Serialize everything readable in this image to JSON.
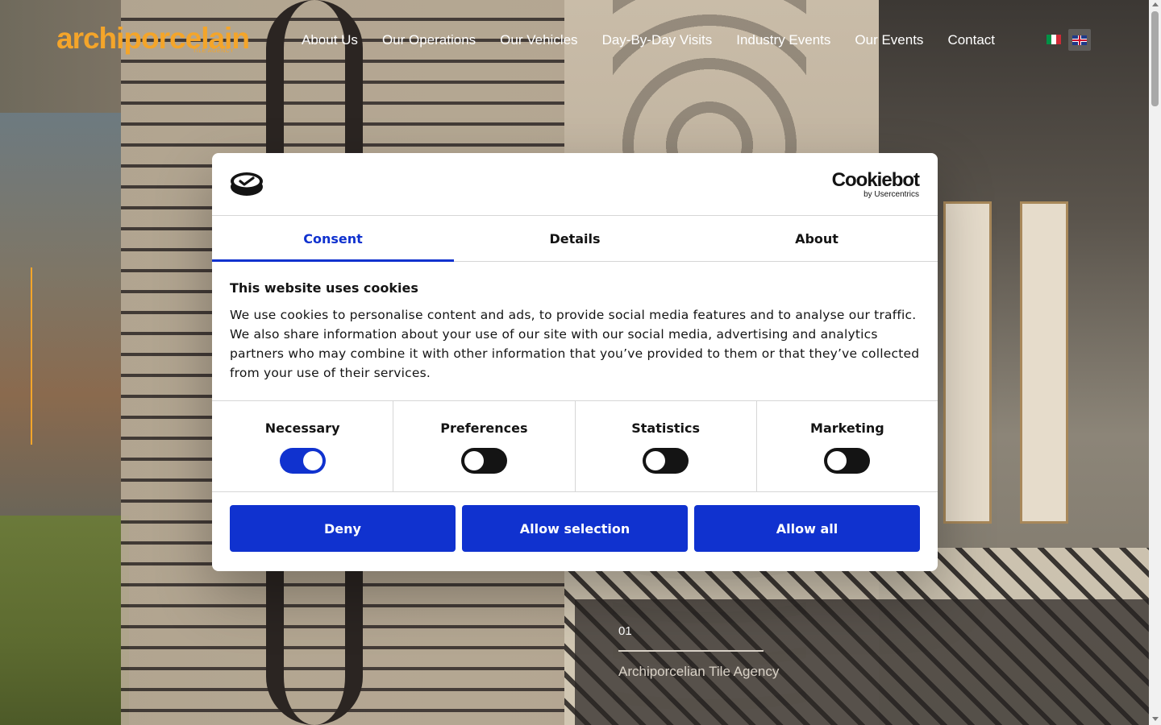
{
  "site": {
    "logo_text": "archiporcelain",
    "logo_sub": "TILE AGENCY",
    "nav": [
      {
        "label": "About Us"
      },
      {
        "label": "Our Operations"
      },
      {
        "label": "Our Vehicles"
      },
      {
        "label": "Day-By-Day Visits"
      },
      {
        "label": "Industry Events"
      },
      {
        "label": "Our Events"
      },
      {
        "label": "Contact"
      }
    ],
    "languages": [
      {
        "code": "it",
        "icon": "italian-flag-icon"
      },
      {
        "code": "en",
        "icon": "uk-flag-icon",
        "selected": true
      }
    ],
    "accent_color": "#f4a52a"
  },
  "hero": {
    "slide_number": "01",
    "caption": "Archiporcelian Tile Agency"
  },
  "cookie_dialog": {
    "brand_name": "Cookiebot",
    "brand_by": "by Usercentrics",
    "logo_icon": "cookiebot-logo-icon",
    "tabs": [
      {
        "label": "Consent",
        "active": true
      },
      {
        "label": "Details",
        "active": false
      },
      {
        "label": "About",
        "active": false
      }
    ],
    "title": "This website uses cookies",
    "body": "We use cookies to personalise content and ads, to provide social media features and to analyse our traffic. We also share information about your use of our site with our social media, advertising and analytics partners who may combine it with other information that you’ve provided to them or that they’ve collected from your use of their services.",
    "toggles": [
      {
        "label": "Necessary",
        "on": true
      },
      {
        "label": "Preferences",
        "on": false
      },
      {
        "label": "Statistics",
        "on": false
      },
      {
        "label": "Marketing",
        "on": false
      }
    ],
    "buttons": {
      "deny": "Deny",
      "allow_selection": "Allow selection",
      "allow_all": "Allow all"
    },
    "accent_color": "#1032cf"
  }
}
